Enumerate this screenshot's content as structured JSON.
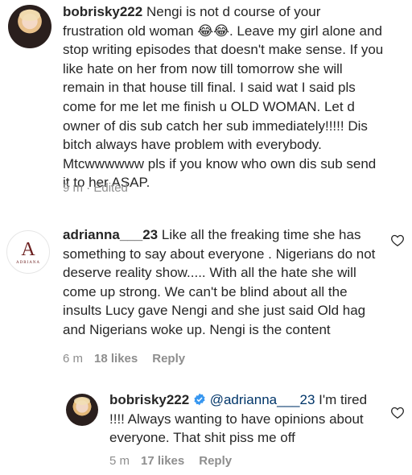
{
  "comments": [
    {
      "username": "bobrisky222",
      "text": "Nengi is not d course of your frustration old woman 😂😂. Leave my girl alone and stop writing episodes that doesn't make sense. If you like hate on her from now till tomorrow she will remain in that house till final. I said wat I said pls come for me let me finish u OLD WOMAN. Let d owner of dis sub catch her sub immediately!!!!! Dis bitch always have problem with everybody. Mtcwwwwww pls if you know who own dis sub send it to her ASAP.",
      "time": "9 m",
      "edited": "Edited"
    },
    {
      "username": "adrianna___23",
      "avatar_monogram": "A",
      "avatar_brand": "ADRIANA",
      "text": "Like all the freaking time she has something to say about everyone . Nigerians do not deserve reality show..... With all the hate she will come up strong. We can't be blind about all the insults Lucy gave Nengi and she just said Old hag and Nigerians woke up. Nengi is the content",
      "time": "6 m",
      "likes": "18 likes",
      "reply": "Reply"
    },
    {
      "username": "bobrisky222",
      "mention": "@adrianna___23",
      "text": "I'm tired !!!! Always wanting to have opinions about everyone. That shit piss me off",
      "time": "5 m",
      "likes": "17 likes",
      "reply": "Reply"
    }
  ],
  "icons": {
    "heart": "heart-outline-icon",
    "verified": "verified-badge-icon"
  },
  "colors": {
    "text": "#262626",
    "muted": "#8e8e8e",
    "mention": "#003569",
    "verified": "#3897f0"
  }
}
